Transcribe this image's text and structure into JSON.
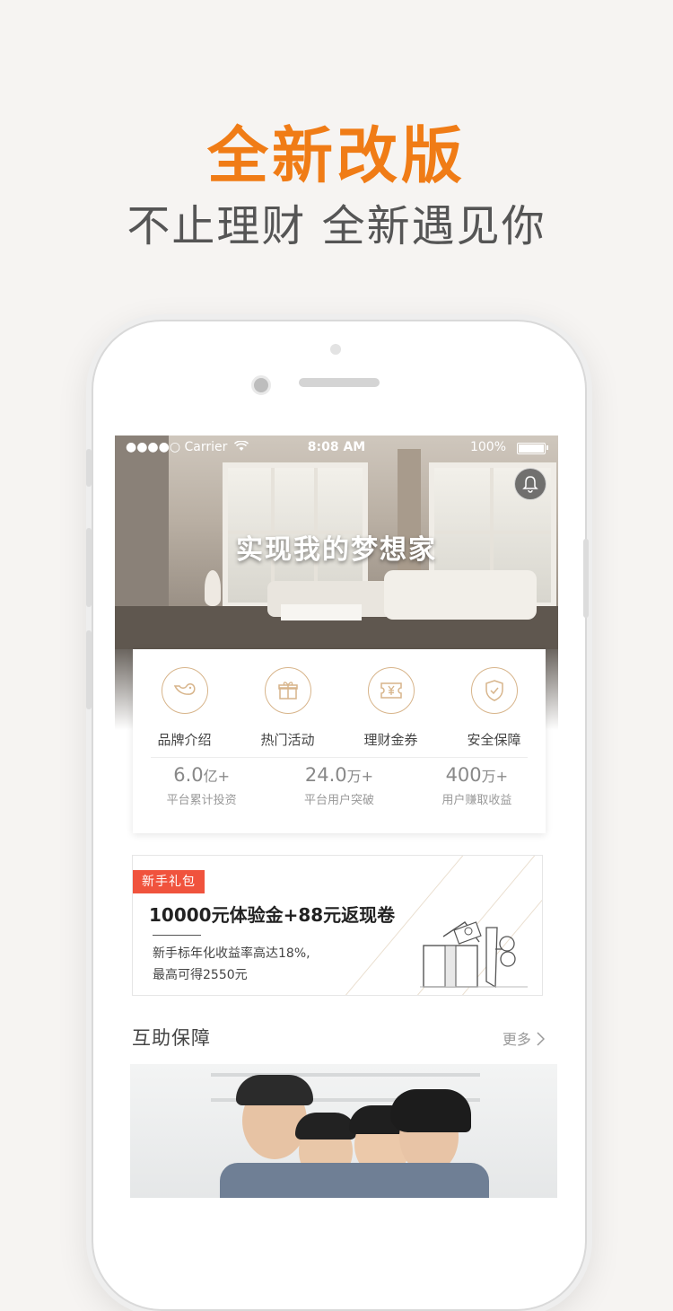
{
  "promo": {
    "headline": "全新改版",
    "subline": "不止理财 全新遇见你"
  },
  "status_bar": {
    "carrier": "●●●●○ Carrier",
    "time": "8:08 AM",
    "battery": "100%"
  },
  "hero": {
    "title": "实现我的梦想家"
  },
  "menu": {
    "items": [
      {
        "label": "品牌介绍",
        "icon": "brand-bird-icon"
      },
      {
        "label": "热门活动",
        "icon": "gift-box-icon"
      },
      {
        "label": "理财金券",
        "icon": "yen-coupon-icon"
      },
      {
        "label": "安全保障",
        "icon": "shield-check-icon"
      }
    ]
  },
  "stats": [
    {
      "value": "6.0",
      "unit": "亿+",
      "caption": "平台累计投资"
    },
    {
      "value": "24.0",
      "unit": "万+",
      "caption": "平台用户突破"
    },
    {
      "value": "400",
      "unit": "万+",
      "caption": "用户赚取收益"
    }
  ],
  "gift": {
    "tag": "新手礼包",
    "headline": "10000元体验金+88元返现卷",
    "line1": "新手标年化收益率高达18%,",
    "line2": "最高可得2550元"
  },
  "section": {
    "title": "互助保障",
    "more": "更多"
  },
  "colors": {
    "accent": "#f07c16",
    "tag_red": "#f0533d",
    "icon_gold": "#d7b48a"
  }
}
